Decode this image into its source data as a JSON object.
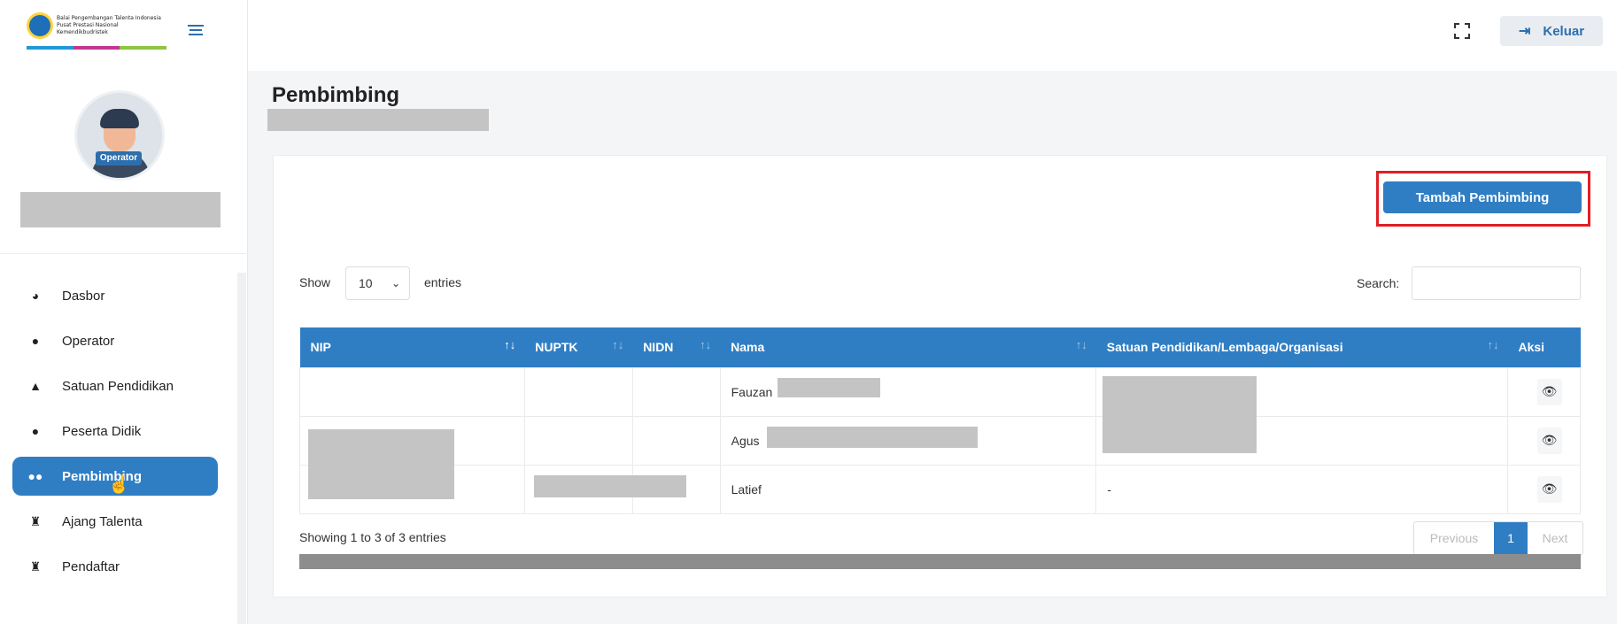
{
  "brand": {
    "text_line1": "Balai Pengembangan Talenta Indonesia",
    "text_line2": "Pusat Prestasi Nasional",
    "text_line3": "Kemendikbudristek",
    "stripe_colors": [
      "#1e9ad6",
      "#c2378f",
      "#8cc63f"
    ]
  },
  "profile": {
    "badge": "Operator"
  },
  "sidebar": {
    "items": [
      {
        "label": "Dasbor",
        "icon": "dashboard-icon",
        "glyph": "◕"
      },
      {
        "label": "Operator",
        "icon": "user-icon",
        "glyph": "👤"
      },
      {
        "label": "Satuan Pendidikan",
        "icon": "graduation-cap-icon",
        "glyph": "🎓"
      },
      {
        "label": "Peserta Didik",
        "icon": "user-icon",
        "glyph": "👤"
      },
      {
        "label": "Pembimbing",
        "icon": "users-icon",
        "glyph": "👥"
      },
      {
        "label": "Ajang Talenta",
        "icon": "trophy-icon",
        "glyph": "🏆"
      },
      {
        "label": "Pendaftar",
        "icon": "trophy-icon",
        "glyph": "🏆"
      }
    ],
    "active_index": 4
  },
  "topbar": {
    "logout_label": "Keluar"
  },
  "page": {
    "title": "Pembimbing"
  },
  "actions": {
    "add_label": "Tambah Pembimbing"
  },
  "table_controls": {
    "show_label": "Show",
    "length_value": "10",
    "entries_label": "entries",
    "search_label": "Search:"
  },
  "table": {
    "columns": [
      "NIP",
      "NUPTK",
      "NIDN",
      "Nama",
      "Satuan Pendidikan/Lembaga/Organisasi",
      "Aksi"
    ],
    "rows": [
      {
        "nip": "",
        "nuptk": "",
        "nidn": "",
        "nama": "Fauzan",
        "satuan": ""
      },
      {
        "nip": "",
        "nuptk": "",
        "nidn": "",
        "nama": "Agus",
        "satuan": ""
      },
      {
        "nip": "",
        "nuptk": "",
        "nidn": "",
        "nama": "Latief",
        "satuan": "-"
      }
    ]
  },
  "footer": {
    "info": "Showing 1 to 3 of 3 entries",
    "previous": "Previous",
    "current_page": "1",
    "next": "Next"
  },
  "colors": {
    "primary": "#2f7ec4",
    "highlight": "#e01e26"
  }
}
